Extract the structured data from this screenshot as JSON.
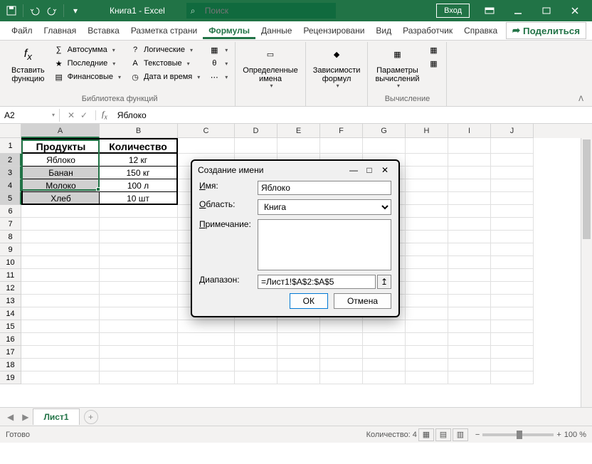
{
  "titlebar": {
    "doc_title": "Книга1 - Excel",
    "search_placeholder": "Поиск",
    "login": "Вход"
  },
  "tabs": {
    "items": [
      "Файл",
      "Главная",
      "Вставка",
      "Разметка страни",
      "Формулы",
      "Данные",
      "Рецензировани",
      "Вид",
      "Разработчик",
      "Справка"
    ],
    "active": 4,
    "share": "Поделиться"
  },
  "ribbon": {
    "insert_fn": "Вставить\nфункцию",
    "autosum": "Автосумма",
    "recent": "Последние",
    "financial": "Финансовые",
    "logical": "Логические",
    "text": "Текстовые",
    "datetime": "Дата и время",
    "defined_names": "Определенные\nимена",
    "deps": "Зависимости\nформул",
    "params": "Параметры\nвычислений",
    "group_lib": "Библиотека функций",
    "group_calc": "Вычисление"
  },
  "namebox": {
    "ref": "A2",
    "formula": "Яблоко"
  },
  "columns": [
    "A",
    "B",
    "C",
    "D",
    "E",
    "F",
    "G",
    "H",
    "I",
    "J"
  ],
  "table": {
    "headers": [
      "Продукты",
      "Количество"
    ],
    "rows": [
      [
        "Яблоко",
        "12 кг"
      ],
      [
        "Банан",
        "150 кг"
      ],
      [
        "Молоко",
        "100 л"
      ],
      [
        "Хлеб",
        "10 шт"
      ]
    ]
  },
  "sheet_tabs": {
    "active": "Лист1"
  },
  "statusbar": {
    "ready": "Готово",
    "count_label": "Количество: 4",
    "zoom": "100 %"
  },
  "dialog": {
    "title": "Создание имени",
    "name_label": "Имя:",
    "name_value": "Яблоко",
    "scope_label": "Область:",
    "scope_value": "Книга",
    "comment_label": "Примечание:",
    "range_label": "Диапазон:",
    "range_value": "=Лист1!$A$2:$A$5",
    "ok": "ОК",
    "cancel": "Отмена"
  }
}
